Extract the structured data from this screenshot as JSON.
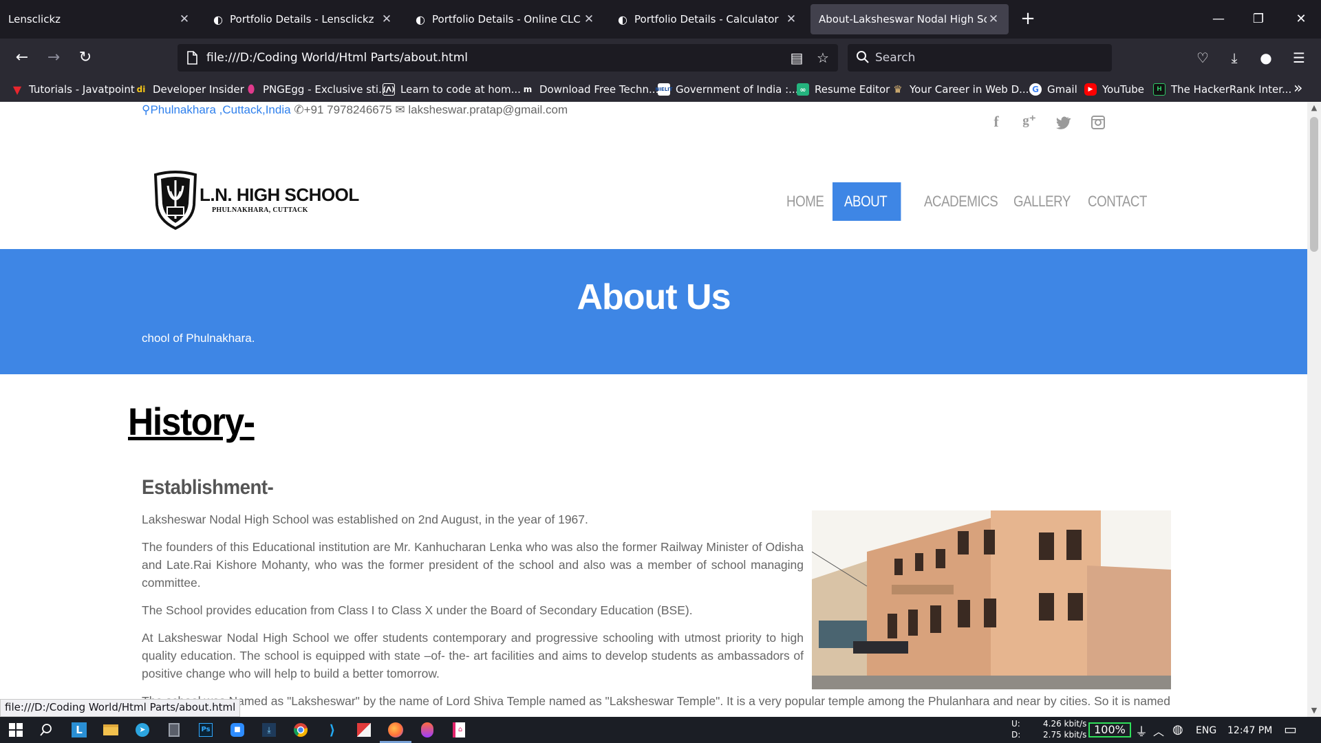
{
  "browser": {
    "tabs": [
      {
        "title": "Lensclickz",
        "active": false
      },
      {
        "title": "Portfolio Details - Lensclickz",
        "active": false
      },
      {
        "title": "Portfolio Details - Online CLC Sys",
        "active": false
      },
      {
        "title": "Portfolio Details - Calculator",
        "active": false
      },
      {
        "title": "About-Laksheswar Nodal High Schoo",
        "active": true
      }
    ],
    "url": "file:///D:/Coding World/Html Parts/about.html",
    "search_placeholder": "Search",
    "bookmarks": [
      {
        "label": "Tutorials - Javatpoint",
        "icon": "javatpoint-icon"
      },
      {
        "label": "Developer Insider",
        "icon": "developer-insider-icon"
      },
      {
        "label": "PNGEgg - Exclusive sti...",
        "icon": "pngegg-icon"
      },
      {
        "label": "Learn to code at hom...",
        "icon": "freecodecamp-icon"
      },
      {
        "label": "Download Free Techn...",
        "icon": "tech-download-icon"
      },
      {
        "label": "Government of India :...",
        "icon": "nielit-icon"
      },
      {
        "label": "Resume Editor",
        "icon": "resume-editor-icon"
      },
      {
        "label": "Your Career in Web D...",
        "icon": "career-icon"
      },
      {
        "label": "Gmail",
        "icon": "google-icon"
      },
      {
        "label": "YouTube",
        "icon": "youtube-icon"
      },
      {
        "label": "The HackerRank Inter...",
        "icon": "hackerrank-icon"
      }
    ],
    "status_link": "file:///D:/Coding World/Html Parts/about.html"
  },
  "page": {
    "contact": {
      "location": "Phulnakhara ,Cuttack,India",
      "phone": "+91 7978246675",
      "email": "laksheswar.pratap@gmail.com"
    },
    "social_icons": [
      "facebook-icon",
      "google-plus-icon",
      "twitter-icon",
      "instagram-icon"
    ],
    "logo": {
      "name": "L.N. HIGH SCHOOL",
      "tagline": "PHULNAKHARA, CUTTACK"
    },
    "menu": [
      {
        "label": "HOME",
        "active": false
      },
      {
        "label": "ABOUT US",
        "active": true
      },
      {
        "label": "ACADEMICS",
        "active": false
      },
      {
        "label": "GALLERY",
        "active": false
      },
      {
        "label": "CONTACT",
        "active": false
      }
    ],
    "hero": {
      "title": "About Us",
      "subtitle": "chool of Phulnakhara."
    },
    "history_heading": " History-",
    "establishment_heading": "Establishment-",
    "paragraphs": [
      "Laksheswar Nodal High School was established on 2nd August, in the year of 1967.",
      "The founders of this Educational institution are Mr. Kanhucharan Lenka who was also the former Railway Minister of Odisha and Late.Rai Kishore Mohanty, who was the former president of the school and also was a member of school managing committee.",
      "The School provides education from Class I to Class X under the Board of Secondary Education (BSE).",
      "At Laksheswar Nodal High School we offer students contemporary and progressive schooling with utmost priority to high quality education. The school is equipped with state –of- the- art facilities and aims to develop students as ambassadors of positive change who will help to build a better tomorrow.",
      "The school was Named as \"Laksheswar\" by the name of Lord Shiva Temple named as \"Laksheswar Temple\". It is a very popular temple among the Phulanhara and near by cities. So it is named"
    ]
  },
  "taskbar": {
    "net_up_label": "U:",
    "net_down_label": "D:",
    "net_up": "4.26 kbit/s",
    "net_down": "2.75 kbit/s",
    "battery": "100%",
    "language": "ENG",
    "time": "12:47 PM"
  },
  "colors": {
    "accent": "#3e86e5",
    "link": "#2f80ed",
    "chrome_dark": "#1c1b22",
    "toolbar": "#2b2a33"
  }
}
